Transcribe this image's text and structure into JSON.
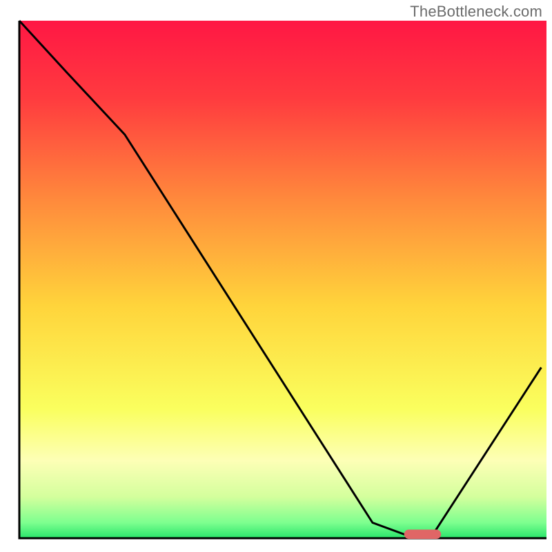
{
  "watermark": "TheBottleneck.com",
  "chart_data": {
    "type": "line",
    "title": "",
    "xlabel": "",
    "ylabel": "",
    "xlim": [
      0,
      100
    ],
    "ylim": [
      0,
      100
    ],
    "background_gradient": {
      "stops": [
        {
          "offset": 0,
          "color": "#ff1744"
        },
        {
          "offset": 15,
          "color": "#ff3b3f"
        },
        {
          "offset": 35,
          "color": "#ff8b3c"
        },
        {
          "offset": 55,
          "color": "#ffd43b"
        },
        {
          "offset": 75,
          "color": "#faff5e"
        },
        {
          "offset": 85,
          "color": "#fdffb6"
        },
        {
          "offset": 92,
          "color": "#d4ff9d"
        },
        {
          "offset": 97,
          "color": "#7dff8f"
        },
        {
          "offset": 100,
          "color": "#29e56b"
        }
      ]
    },
    "series": [
      {
        "name": "bottleneck-curve",
        "color": "#000000",
        "x": [
          0,
          9,
          20,
          67,
          75,
          78,
          99
        ],
        "y": [
          100,
          90,
          78,
          3,
          0,
          0,
          33
        ]
      }
    ],
    "marker": {
      "name": "optimal-marker",
      "color": "#e06666",
      "x_center": 76.5,
      "y": 0,
      "width": 7,
      "height": 1.8
    },
    "axis_color": "#000000",
    "axis_width": 3
  }
}
